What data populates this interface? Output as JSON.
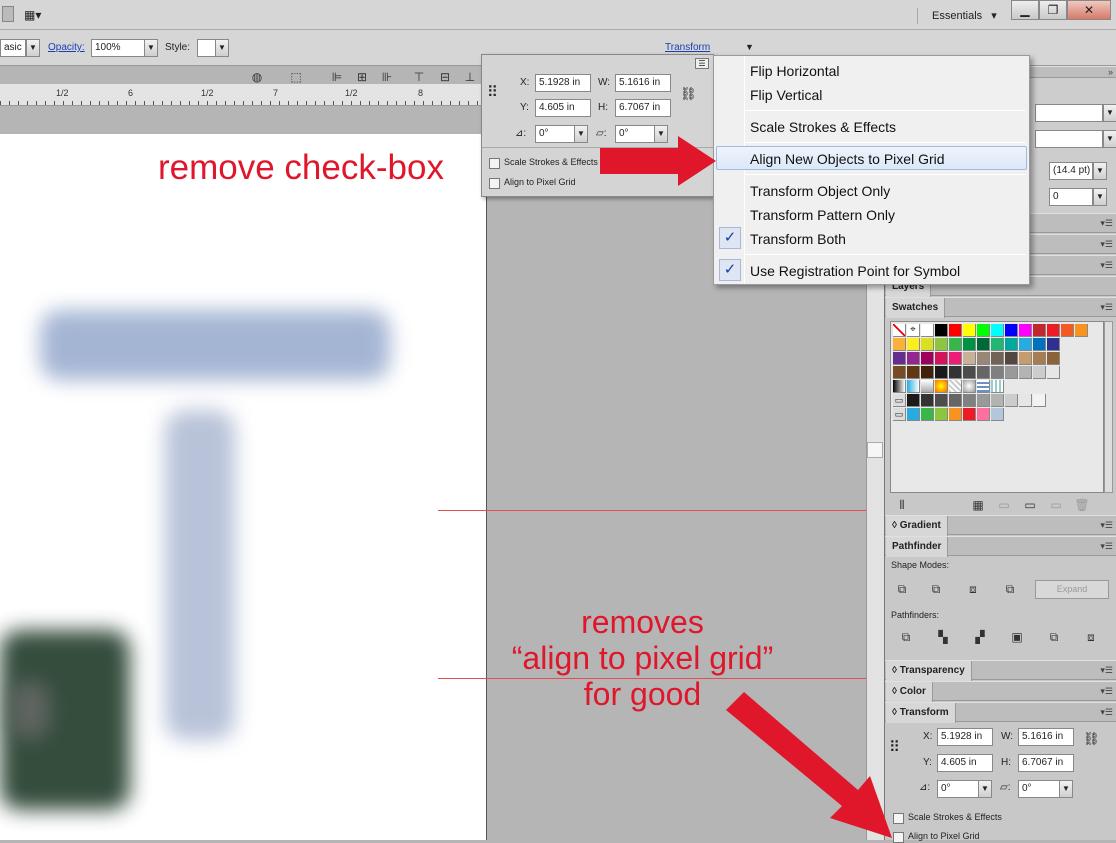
{
  "workspace": {
    "label": "Essentials",
    "caret": "▾"
  },
  "window_buttons": {
    "minimize": "▁",
    "restore": "❐",
    "close": "✕"
  },
  "control_bar": {
    "basic_value": "asic",
    "opacity_label": "Opacity:",
    "opacity_value": "100%",
    "style_label": "Style:",
    "transform_link": "Transform"
  },
  "ruler": {
    "ticks": [
      "1/2",
      "6",
      "1/2",
      "7",
      "1/2",
      "8"
    ]
  },
  "float_transform": {
    "x_label": "X:",
    "x_value": "5.1928 in",
    "y_label": "Y:",
    "y_value": "4.605 in",
    "w_label": "W:",
    "w_value": "5.1616 in",
    "h_label": "H:",
    "h_value": "6.7067 in",
    "angle_value": "0°",
    "shear_value": "0°",
    "scale_strokes": "Scale Strokes & Effects",
    "align_pixel": "Align to Pixel Grid"
  },
  "flyout_menu": {
    "items": [
      {
        "label": "Flip Horizontal",
        "checked": false
      },
      {
        "label": "Flip Vertical",
        "checked": false
      },
      {
        "label": "Scale Strokes & Effects",
        "checked": false
      },
      {
        "label": "Align New Objects to Pixel Grid",
        "checked": false,
        "highlighted": true
      },
      {
        "label": "Transform Object Only",
        "checked": false
      },
      {
        "label": "Transform Pattern Only",
        "checked": false
      },
      {
        "label": "Transform Both",
        "checked": true
      },
      {
        "label": "Use Registration Point for Symbol",
        "checked": true
      }
    ],
    "check_glyph": "✓"
  },
  "annotations": {
    "top": "remove check-box",
    "bottom_line1": "removes",
    "bottom_line2": "“align to pixel grid”",
    "bottom_line3": "for good",
    "color": "#e0162b"
  },
  "panels": {
    "stroke_value1": "(14.4 pt)",
    "stroke_value2": "0",
    "layers": "Layers",
    "swatches": "Swatches",
    "gradient": "Gradient",
    "pathfinder": "Pathfinder",
    "shape_modes": "Shape Modes:",
    "expand": "Expand",
    "pathfinders": "Pathfinders:",
    "transparency": "Transparency",
    "color": "Color",
    "transform": "Transform",
    "t_x_label": "X:",
    "t_x_value": "5.1928 in",
    "t_y_label": "Y:",
    "t_y_value": "4.605 in",
    "t_w_label": "W:",
    "t_w_value": "5.1616 in",
    "t_h_label": "H:",
    "t_h_value": "6.7067 in",
    "t_angle": "0°",
    "t_shear": "0°",
    "t_scale_strokes": "Scale Strokes & Effects",
    "t_align_pixel": "Align to Pixel Grid"
  },
  "swatch_colors": [
    [
      "#ffffff",
      "#000000",
      "#ff0000",
      "#ffff00",
      "#00ff00",
      "#00ffff",
      "#0000ff",
      "#ff00ff",
      "#c1272d",
      "#ed1c24",
      "#f15a24",
      "#f7931e"
    ],
    [
      "#fbb03b",
      "#fcee21",
      "#d9e021",
      "#8cc63f",
      "#39b54a",
      "#009245",
      "#006837",
      "#22b573",
      "#00a99d",
      "#29abe2",
      "#0071bc",
      "#2e3192"
    ],
    [
      "#662d91",
      "#93278f",
      "#9e005d",
      "#d4145a",
      "#ed1e79",
      "#c7b299",
      "#998675",
      "#736357",
      "#534741",
      "#c69c6d",
      "#a67c52",
      "#8c6239"
    ],
    [
      "#754c24",
      "#603813",
      "#42210b",
      "#1a1a1a",
      "#333333",
      "#4d4d4d",
      "#666666",
      "#808080",
      "#999999",
      "#b3b3b3",
      "#cccccc",
      "#e6e6e6"
    ]
  ],
  "swatch_group2": [
    "#1a1a1a",
    "#333333",
    "#4d4d4d",
    "#666666",
    "#808080",
    "#999999",
    "#b3b3b3",
    "#cccccc",
    "#e6e6e6",
    "#f2f2f2"
  ],
  "swatch_group3": [
    "#29abe2",
    "#39b54a",
    "#8cc63f",
    "#f7931e",
    "#ed1c24",
    "#ff6f9f",
    "#b3c7dc"
  ]
}
